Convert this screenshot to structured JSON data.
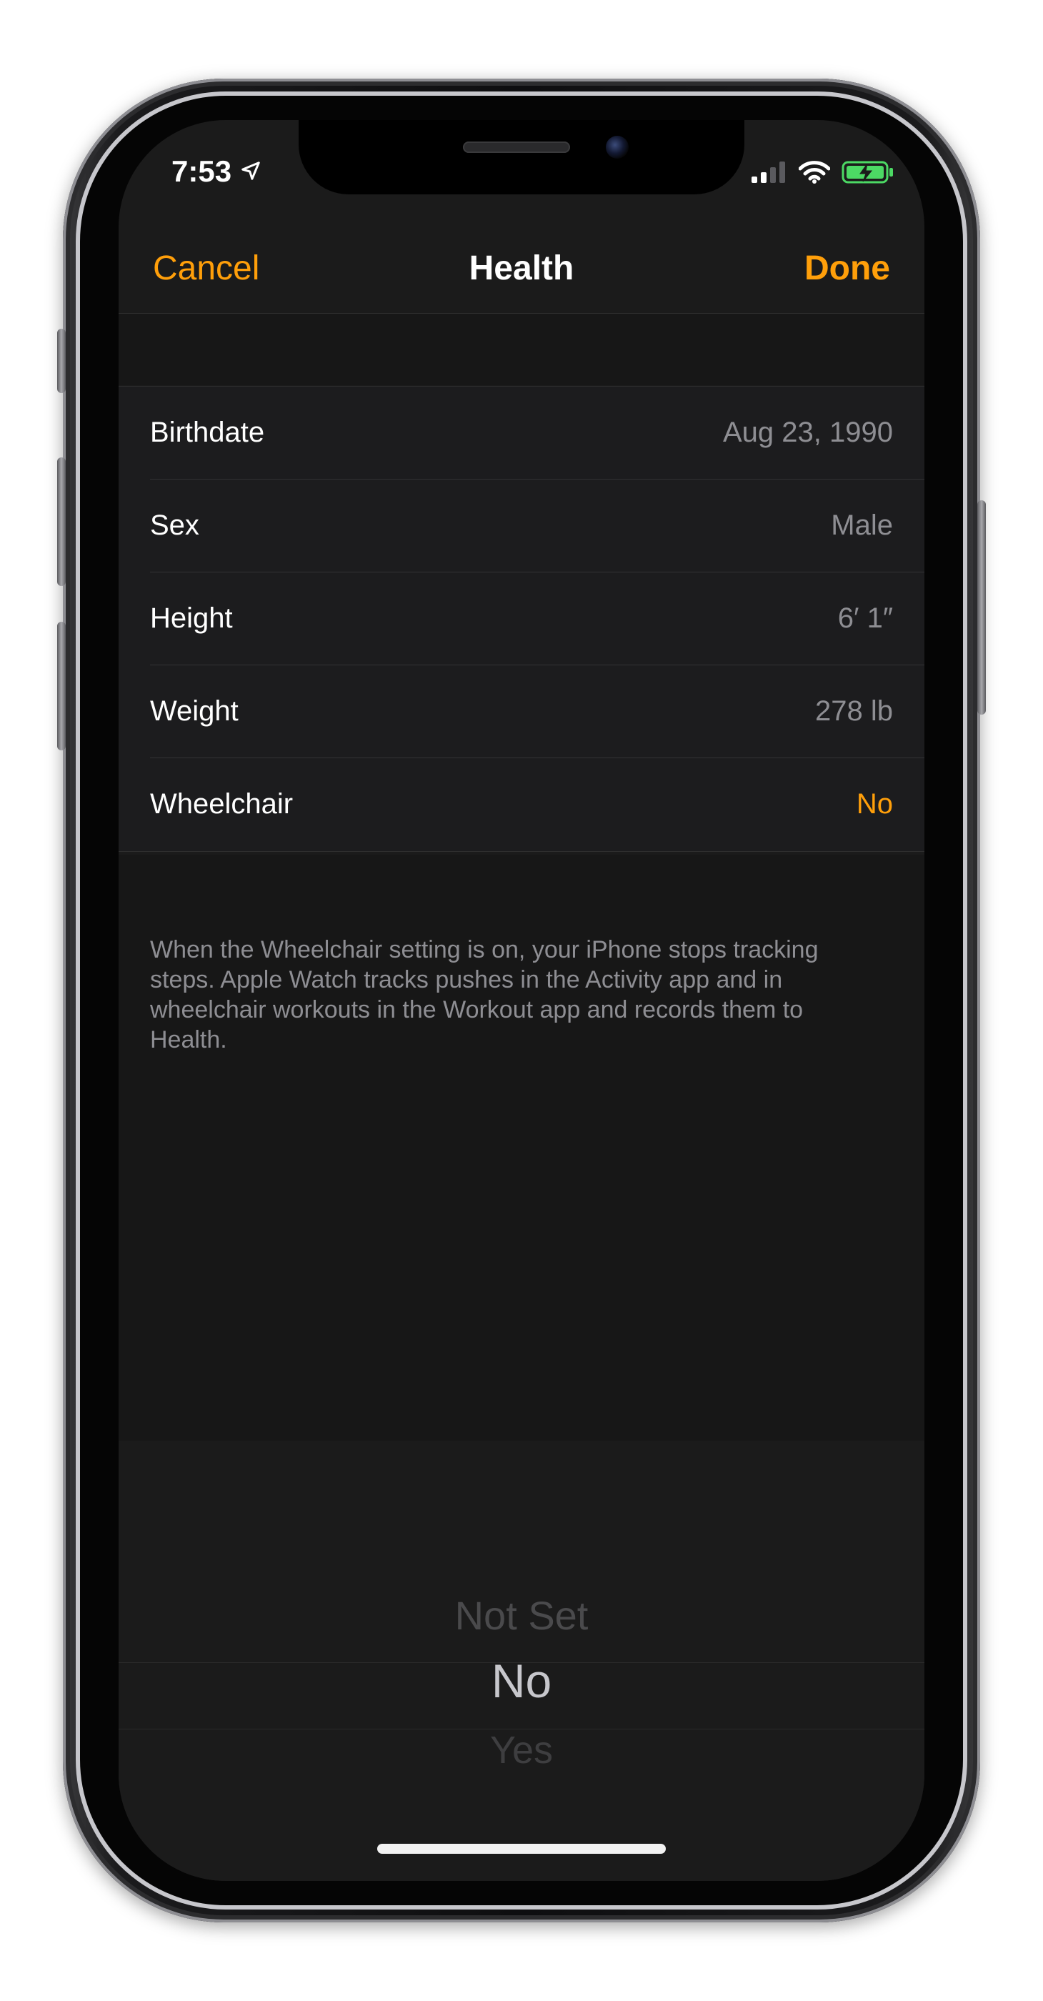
{
  "status_bar": {
    "time": "7:53",
    "icons": [
      "location-arrow-icon",
      "cellular-signal-icon",
      "wifi-icon",
      "battery-charging-icon"
    ],
    "battery_color": "#4cd964"
  },
  "nav": {
    "cancel_label": "Cancel",
    "title": "Health",
    "done_label": "Done"
  },
  "rows": [
    {
      "label": "Birthdate",
      "value": "Aug 23, 1990"
    },
    {
      "label": "Sex",
      "value": "Male"
    },
    {
      "label": "Height",
      "value": "6′ 1″"
    },
    {
      "label": "Weight",
      "value": "278 lb"
    },
    {
      "label": "Wheelchair",
      "value": "No"
    }
  ],
  "footer_note": "When the Wheelchair setting is on, your iPhone stops tracking steps. Apple Watch tracks pushes in the Activity app and in wheelchair workouts in the Workout app and records them to Health.",
  "picker": {
    "options": [
      "Not Set",
      "No",
      "Yes"
    ],
    "selected": "No"
  },
  "colors": {
    "accent": "#ff9f0a",
    "background": "#1b1b1b",
    "secondary_text": "#8e8e93"
  }
}
